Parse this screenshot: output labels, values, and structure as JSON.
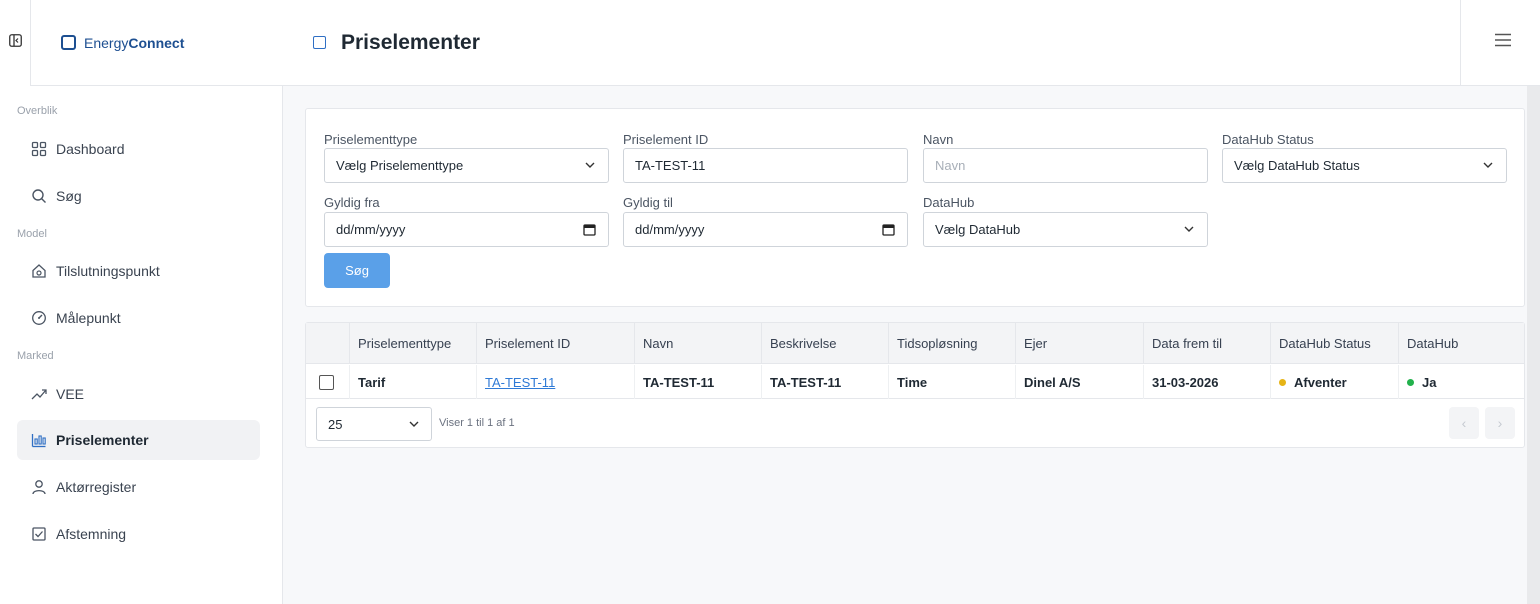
{
  "brand": {
    "name_light": "Energy",
    "name_bold": "Connect"
  },
  "header": {
    "title": "Priselementer"
  },
  "sidebar": {
    "sections": [
      "Overblik",
      "Model",
      "Marked"
    ],
    "items": [
      {
        "label": "Dashboard",
        "icon": "grid-icon"
      },
      {
        "label": "Søg",
        "icon": "search-icon"
      },
      {
        "label": "Tilslutningspunkt",
        "icon": "house-icon"
      },
      {
        "label": "Målepunkt",
        "icon": "gauge-icon"
      },
      {
        "label": "VEE",
        "icon": "trend-icon"
      },
      {
        "label": "Priselementer",
        "icon": "price-chart-icon",
        "active": true
      },
      {
        "label": "Aktørregister",
        "icon": "user-icon"
      },
      {
        "label": "Afstemning",
        "icon": "checklist-icon"
      }
    ]
  },
  "filters": {
    "type": {
      "label": "Priselementtype",
      "value": "Vælg Priselementtype"
    },
    "id": {
      "label": "Priselement ID",
      "value": "TA-TEST-11"
    },
    "name": {
      "label": "Navn",
      "placeholder": "Navn"
    },
    "status": {
      "label": "DataHub Status",
      "value": "Vælg DataHub Status"
    },
    "valid_from": {
      "label": "Gyldig fra",
      "value": "dd/mm/yyyy"
    },
    "valid_to": {
      "label": "Gyldig til",
      "value": "dd/mm/yyyy"
    },
    "datahub": {
      "label": "DataHub",
      "value": "Vælg DataHub"
    },
    "search_button": "Søg"
  },
  "table": {
    "columns": [
      "Priselementtype",
      "Priselement ID",
      "Navn",
      "Beskrivelse",
      "Tidsopløsning",
      "Ejer",
      "Data frem til",
      "DataHub Status",
      "DataHub"
    ],
    "rows": [
      {
        "type": "Tarif",
        "id": "TA-TEST-11",
        "name": "TA-TEST-11",
        "description": "TA-TEST-11",
        "resolution": "Time",
        "owner": "Dinel A/S",
        "data_until": "31-03-2026",
        "status": "Afventer",
        "status_color": "#e6b417",
        "datahub": "Ja",
        "datahub_color": "#22b14c"
      }
    ],
    "page_size": "25",
    "info": "Viser 1 til 1 af 1"
  }
}
